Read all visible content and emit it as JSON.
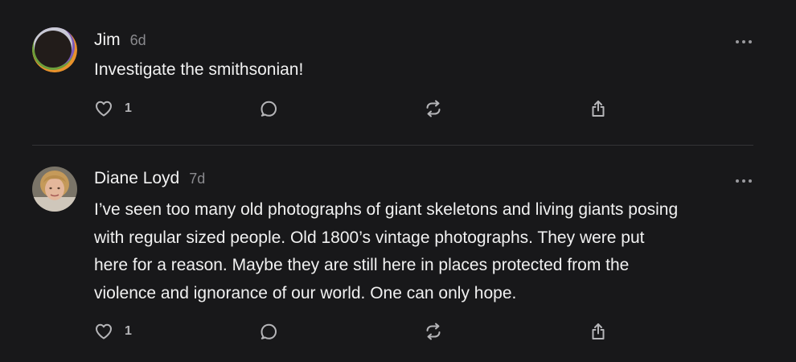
{
  "comments": [
    {
      "author": "Jim",
      "time": "6d",
      "text": "Investigate the smithsonian!",
      "likes": "1",
      "icons": [
        "heart-icon",
        "comment-icon",
        "repost-icon",
        "share-icon",
        "more-icon"
      ]
    },
    {
      "author": "Diane Loyd",
      "time": "7d",
      "text": "I’ve seen too many old photographs of giant skeletons and living giants posing\nwith regular sized people. Old 1800’s vintage photographs. They were put\nhere for a reason. Maybe they are still here in places protected from the\nviolence and ignorance of our world. One can only hope.",
      "likes": "1",
      "icons": [
        "heart-icon",
        "comment-icon",
        "repost-icon",
        "share-icon",
        "more-icon"
      ]
    }
  ],
  "colors": {
    "background": "#18181a",
    "text": "#f1f1f1",
    "muted": "#8a8a8e",
    "icon": "#b5b5b8",
    "divider": "#333336"
  }
}
